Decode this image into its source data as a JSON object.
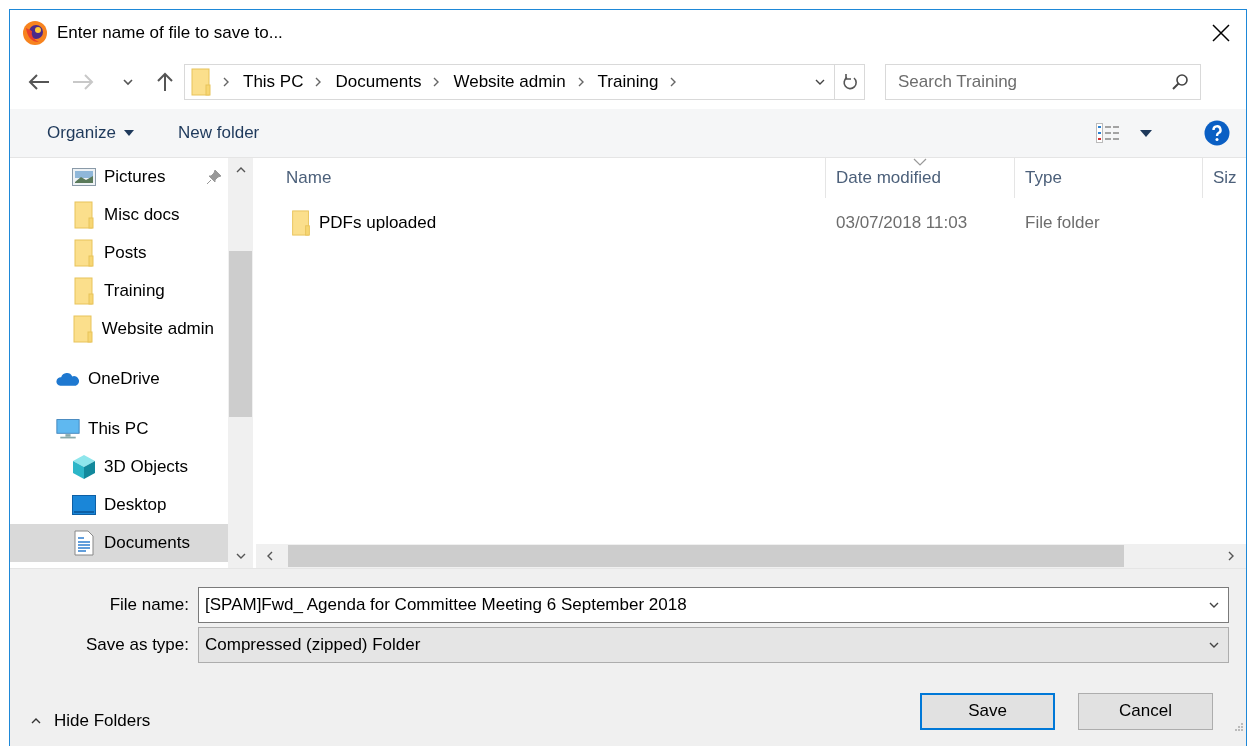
{
  "window": {
    "title": "Enter name of file to save to..."
  },
  "nav_buttons": [
    {
      "kind": "back",
      "disabled": false
    },
    {
      "kind": "forward",
      "disabled": true
    },
    {
      "kind": "recent",
      "disabled": false
    },
    {
      "kind": "up",
      "disabled": false
    }
  ],
  "address_bar": {
    "breadcrumbs": [
      "This PC",
      "Documents",
      "Website admin",
      "Training"
    ]
  },
  "search": {
    "placeholder": "Search Training"
  },
  "toolbar": {
    "organize": "Organize",
    "new_folder": "New folder"
  },
  "navigation": {
    "quick_access_items": [
      {
        "label": "Pictures",
        "kind": "pictures",
        "pinned": true,
        "selected": false
      },
      {
        "label": "Misc docs",
        "kind": "folder",
        "pinned": false,
        "selected": false
      },
      {
        "label": "Posts",
        "kind": "folder",
        "pinned": false,
        "selected": false
      },
      {
        "label": "Training",
        "kind": "folder",
        "pinned": false,
        "selected": false
      },
      {
        "label": "Website admin",
        "kind": "folder",
        "pinned": false,
        "selected": false
      }
    ],
    "roots": [
      {
        "label": "OneDrive",
        "kind": "cloud",
        "selected": false
      },
      {
        "label": "This PC",
        "kind": "pc",
        "selected": false,
        "children": [
          {
            "label": "3D Objects",
            "kind": "cube",
            "selected": false
          },
          {
            "label": "Desktop",
            "kind": "desktop",
            "selected": false
          },
          {
            "label": "Documents",
            "kind": "documents",
            "selected": true
          }
        ]
      }
    ]
  },
  "table": {
    "columns": [
      {
        "label": "Name",
        "sorted": false
      },
      {
        "label": "Date modified",
        "sorted": true
      },
      {
        "label": "Type",
        "sorted": false
      },
      {
        "label": "Siz",
        "sorted": false
      }
    ],
    "rows": [
      {
        "name": "PDFs uploaded",
        "date_modified": "03/07/2018 11:03",
        "type": "File folder",
        "selected": false
      }
    ]
  },
  "file_name": {
    "label": "File name:",
    "value": "[SPAM]Fwd_ Agenda for Committee Meeting 6 September 2018"
  },
  "save_as_type": {
    "label": "Save as type:",
    "value": "Compressed (zipped) Folder"
  },
  "hide_folders": "Hide Folders",
  "buttons": [
    {
      "label": "Save",
      "default": true
    },
    {
      "label": "Cancel",
      "default": false
    }
  ]
}
